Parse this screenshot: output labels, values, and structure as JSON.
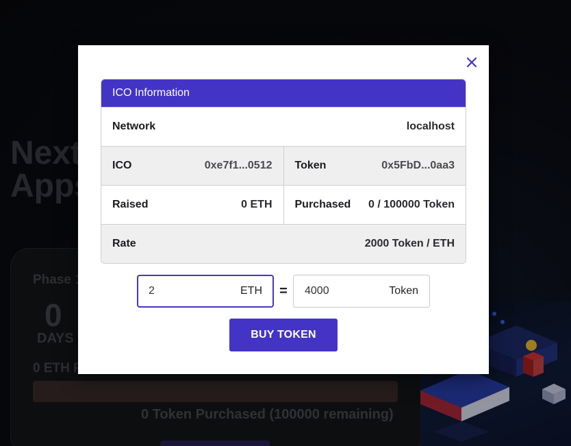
{
  "background": {
    "hero_line1": "Next",
    "hero_line2": "Apps",
    "phase_label": "Phase 1",
    "countdown_value": "0",
    "countdown_unit": "DAYS",
    "eth_raised": "0 ETH R",
    "purchased_summary": "0 Token Purchased (100000 remaining)"
  },
  "modal": {
    "close_icon": "close-icon",
    "info_card": {
      "title": "ICO Information",
      "network_label": "Network",
      "network_value": "localhost",
      "ico_label": "ICO",
      "ico_value": "0xe7f1...0512",
      "token_label": "Token",
      "token_value": "0x5FbD...0aa3",
      "raised_label": "Raised",
      "raised_value": "0 ETH",
      "purchased_label": "Purchased",
      "purchased_value": "0 / 100000 Token",
      "rate_label": "Rate",
      "rate_value": "2000 Token / ETH"
    },
    "converter": {
      "eth_value": "2",
      "eth_unit": "ETH",
      "equals": "=",
      "token_value": "4000",
      "token_unit": "Token"
    },
    "buy_button": "BUY TOKEN"
  },
  "colors": {
    "accent": "#4434c6",
    "row_alt": "#efefef",
    "border": "#cfcfd4"
  }
}
